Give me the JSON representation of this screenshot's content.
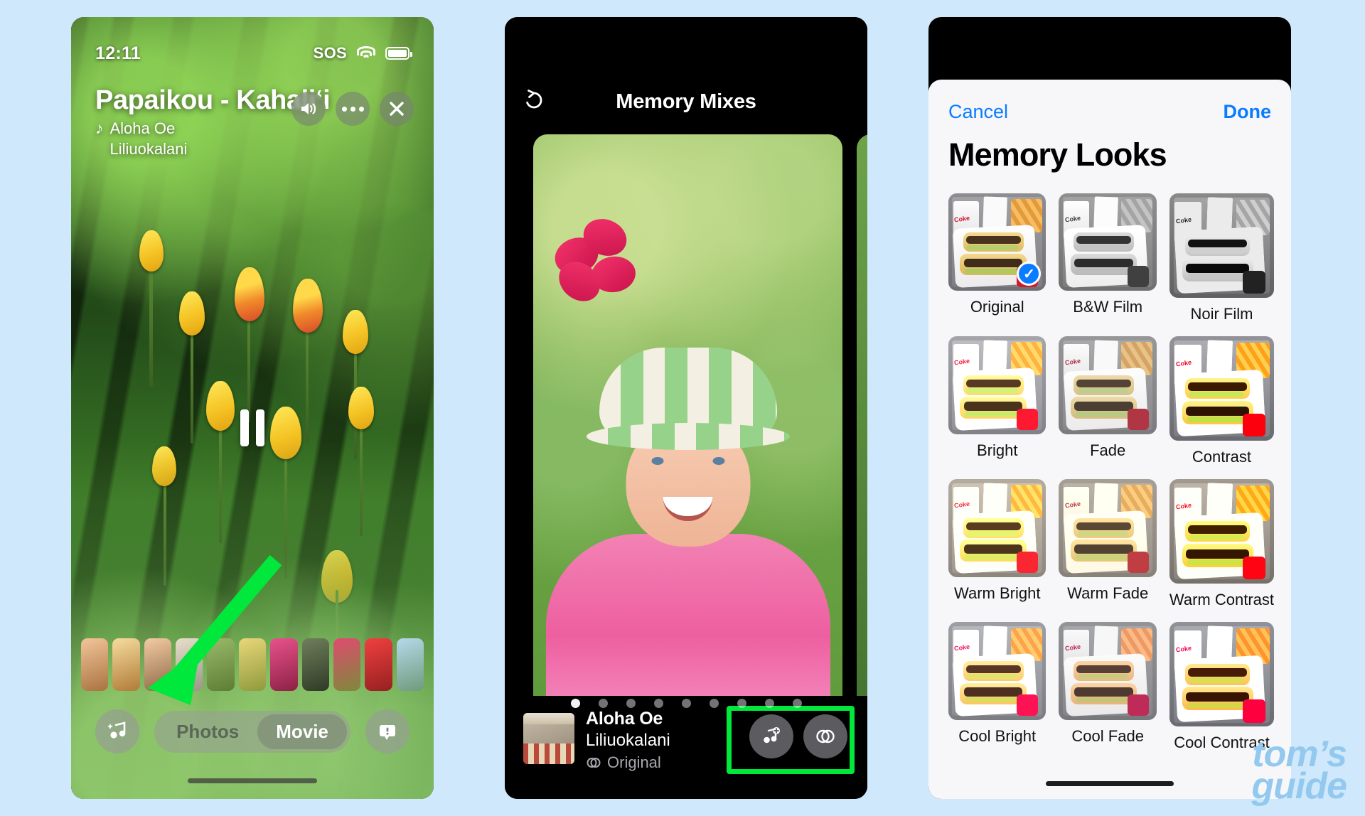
{
  "phone1": {
    "status": {
      "time": "12:11",
      "sos": "SOS",
      "wifi_icon": "wifi-icon",
      "battery_icon": "battery-icon"
    },
    "memory_title": "Papaikou - Kahali‘i",
    "music_note_icon": "music-note-icon",
    "song": "Aloha Oe",
    "artist": "Liliuokalani",
    "top_buttons": [
      {
        "name": "speaker-button",
        "icon": "speaker-icon"
      },
      {
        "name": "more-options-button",
        "icon": "ellipsis-icon"
      },
      {
        "name": "close-button",
        "icon": "close-icon"
      }
    ],
    "playback": {
      "state_icon": "pause-icon"
    },
    "music_button_icon": "music-sparkle-icon",
    "segmented": {
      "options": [
        "Photos",
        "Movie"
      ],
      "selected": "Movie"
    },
    "caption_button_icon": "caption-bubble-icon",
    "annotation": {
      "arrow_color": "#00e83c",
      "points_to": "music-sparkle-button"
    }
  },
  "phone2": {
    "back_icon": "undo-reset-icon",
    "title": "Memory Mixes",
    "page_dots": {
      "count": 9,
      "active_index": 0
    },
    "footer": {
      "album_art": "album-artwork",
      "song": "Aloha Oe",
      "artist": "Liliuokalani",
      "look_icon": "filter-circles-icon",
      "look": "Original",
      "actions": [
        {
          "name": "change-music-button",
          "icon": "music-note-plus-icon"
        },
        {
          "name": "memory-looks-button",
          "icon": "filter-circles-icon"
        }
      ],
      "highlight_color": "#00e83c"
    }
  },
  "phone3": {
    "cancel_label": "Cancel",
    "done_label": "Done",
    "heading": "Memory Looks",
    "accent_color": "#0a7cff",
    "selected": "Original",
    "looks": [
      {
        "label": "Original",
        "style": "orig",
        "selected": true
      },
      {
        "label": "B&W Film",
        "style": "bw",
        "selected": false
      },
      {
        "label": "Noir Film",
        "style": "noir",
        "selected": false
      },
      {
        "label": "Bright",
        "style": "bright",
        "selected": false
      },
      {
        "label": "Fade",
        "style": "fade",
        "selected": false
      },
      {
        "label": "Contrast",
        "style": "contrast",
        "selected": false
      },
      {
        "label": "Warm Bright",
        "style": "wbright",
        "selected": false
      },
      {
        "label": "Warm Fade",
        "style": "wfade",
        "selected": false
      },
      {
        "label": "Warm Contrast",
        "style": "wcontrast",
        "selected": false
      },
      {
        "label": "Cool Bright",
        "style": "cbright",
        "selected": false
      },
      {
        "label": "Cool Fade",
        "style": "cfade",
        "selected": false
      },
      {
        "label": "Cool Contrast",
        "style": "ccontrast",
        "selected": false
      }
    ],
    "check_icon": "checkmark-icon"
  },
  "watermark": {
    "line1": "tom’s",
    "line2": "guide"
  }
}
